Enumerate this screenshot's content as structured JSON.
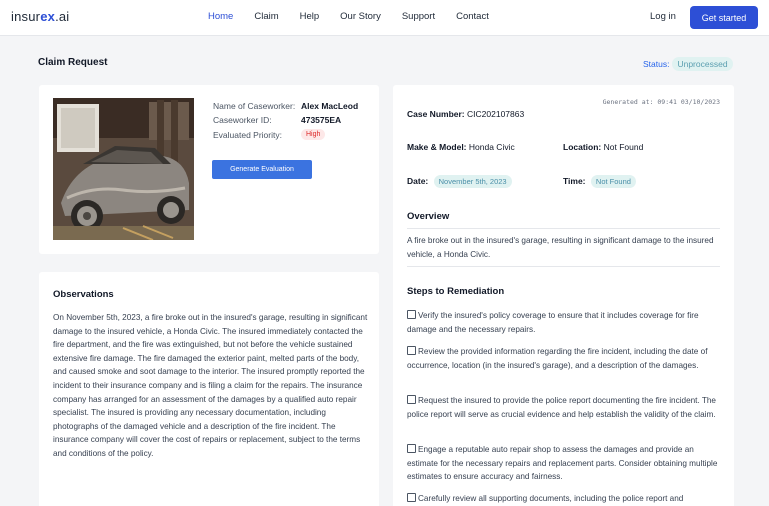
{
  "brand": {
    "prefix": "insur",
    "accent": "ex",
    "suffix": ".ai"
  },
  "nav": {
    "links": [
      "Home",
      "Claim",
      "Help",
      "Our Story",
      "Support",
      "Contact"
    ],
    "login": "Log in",
    "cta": "Get started"
  },
  "page": {
    "title": "Claim Request",
    "status_label": "Status:",
    "status_value": "Unprocessed"
  },
  "caseworker": {
    "name_label": "Name of Caseworker:",
    "name_value": "Alex MacLeod",
    "id_label": "Caseworker ID:",
    "id_value": "473575EA",
    "priority_label": "Evaluated Priority:",
    "priority_value": "High",
    "button": "Generate Evaluation"
  },
  "observations": {
    "title": "Observations",
    "text": "On November 5th, 2023, a fire broke out in the insured's garage, resulting in significant damage to the insured vehicle, a Honda Civic. The insured immediately contacted the fire department, and the fire was extinguished, but not before the vehicle sustained extensive fire damage. The fire damaged the exterior paint, melted parts of the body, and caused smoke and soot damage to the interior. The insured promptly reported the incident to their insurance company and is filing a claim for the repairs. The insurance company has arranged for an assessment of the damages by a qualified auto repair specialist. The insured is providing any necessary documentation, including photographs of the damaged vehicle and a description of the fire incident. The insurance company will cover the cost of repairs or replacement, subject to the terms and conditions of the policy."
  },
  "case": {
    "generated": "Generated at: 09:41 03/10/2023",
    "number_label": "Case Number:",
    "number_value": "CIC202107863",
    "make_label": "Make & Model:",
    "make_value": "Honda Civic",
    "location_label": "Location:",
    "location_value": "Not Found",
    "date_label": "Date:",
    "date_value": "November 5th, 2023",
    "time_label": "Time:",
    "time_value": "Not Found",
    "overview_title": "Overview",
    "overview_text": "A fire broke out in the insured's garage, resulting in significant damage to the insured vehicle, a Honda Civic.",
    "steps_title": "Steps to Remediation",
    "steps": [
      "Verify the insured's policy coverage to ensure that it includes coverage for fire damage and the necessary repairs.",
      "Review the provided information regarding the fire incident, including the date of occurrence, location (in the insured's garage), and a description of the damages.",
      "Request the insured to provide the police report documenting the fire incident. The police report will serve as crucial evidence and help establish the validity of the claim.",
      "Engage a reputable auto repair shop to assess the damages and provide an estimate for the necessary repairs and replacement parts. Consider obtaining multiple estimates to ensure accuracy and fairness.",
      "Carefully review all supporting documents, including the police report and"
    ]
  },
  "colors": {
    "brand": "#2d4fd6",
    "button": "#3b73e0",
    "status": "#2563eb",
    "high_badge": "#dc2626",
    "chip_bg": "#e0f2f1"
  },
  "icons": {
    "checkbox": "checkbox-icon"
  }
}
